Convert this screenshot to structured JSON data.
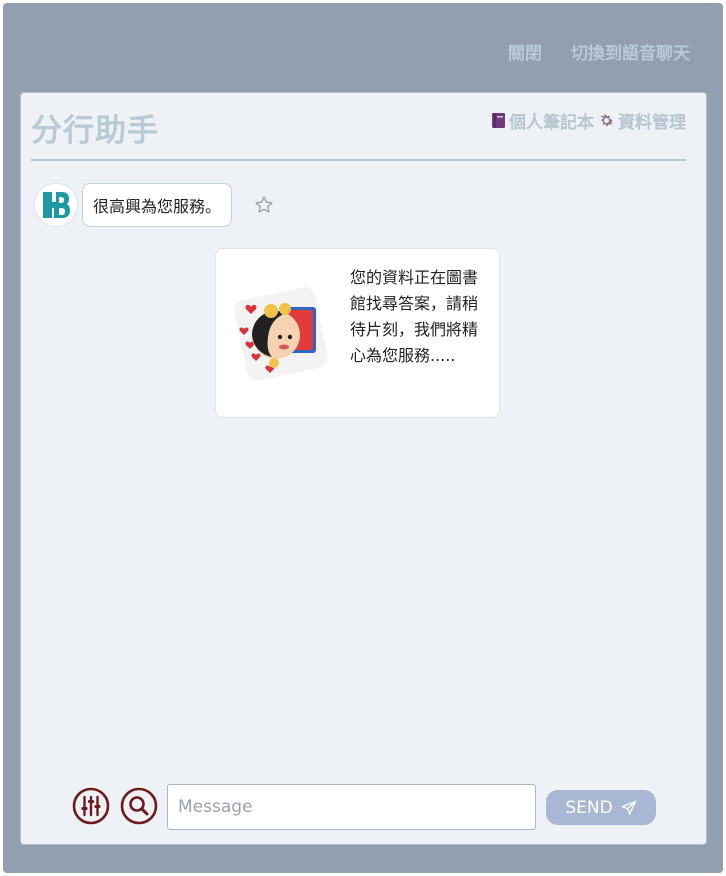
{
  "topbar": {
    "close_label": "關閉",
    "voice_label": "切換到語音聊天"
  },
  "header": {
    "title": "分行助手",
    "notebook_icon": "notebook-icon",
    "notebook_label": "個人筆記本",
    "settings_icon": "gear-icon",
    "data_manage_label": "資料管理"
  },
  "chat": {
    "greeting": "很高興為您服務。",
    "waiting_text": "您的資料正在圖書館找尋答案，請稍待片刻，我們將精心為您服務.....",
    "bot_avatar_icon": "brand-logo-icon",
    "star_icon": "star-icon"
  },
  "input": {
    "placeholder": "Message",
    "send_label": "SEND",
    "send_icon": "paper-plane-icon",
    "tune_icon": "sliders-icon",
    "search_icon": "search-icon"
  },
  "colors": {
    "window_bg": "#929fb1",
    "panel_bg": "#eef1f6",
    "accent": "#a8b7d3",
    "brand_teal": "#1b9aa3",
    "icon_dark_red": "#6b1d1d"
  }
}
